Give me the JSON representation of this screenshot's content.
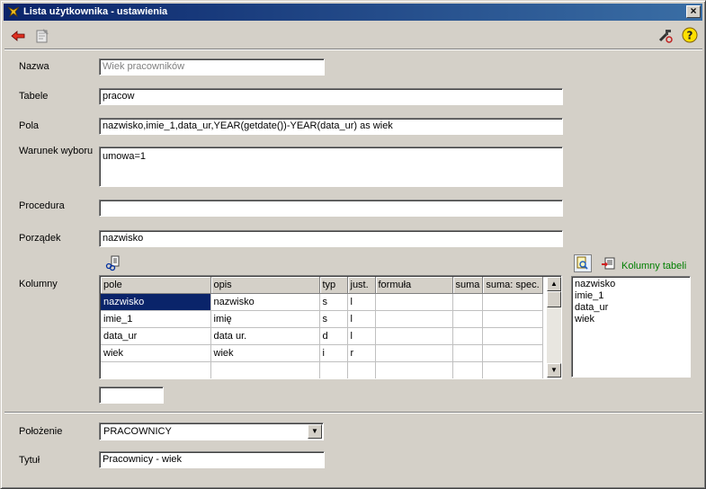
{
  "window": {
    "title": "Lista użytkownika - ustawienia",
    "close_glyph": "×"
  },
  "toolbar": {
    "left_icons": [
      "back-arrow-icon",
      "edit-icon"
    ],
    "right_icons": [
      "tools-icon",
      "help-icon"
    ]
  },
  "form": {
    "nazwa": {
      "label": "Nazwa",
      "value": "Wiek pracowników"
    },
    "tabele": {
      "label": "Tabele",
      "value": "pracow"
    },
    "pola": {
      "label": "Pola",
      "value": "nazwisko,imie_1,data_ur,YEAR(getdate())-YEAR(data_ur) as wiek"
    },
    "warunek": {
      "label": "Warunek wyboru",
      "value": "umowa=1"
    },
    "procedura": {
      "label": "Procedura",
      "value": ""
    },
    "porzadek": {
      "label": "Porządek",
      "value": "nazwisko"
    },
    "kolumny": {
      "label": "Kolumny"
    },
    "small_field": {
      "value": ""
    }
  },
  "grid": {
    "columns": [
      "pole",
      "opis",
      "typ",
      "just.",
      "formuła",
      "suma",
      "suma: spec."
    ],
    "rows": [
      [
        "nazwisko",
        "nazwisko",
        "s",
        "l",
        "",
        "",
        ""
      ],
      [
        "imie_1",
        "imię",
        "s",
        "l",
        "",
        "",
        ""
      ],
      [
        "data_ur",
        "data ur.",
        "d",
        "l",
        "",
        "",
        ""
      ],
      [
        "wiek",
        "wiek",
        "i",
        "r",
        "",
        "",
        ""
      ],
      [
        "",
        "",
        "",
        "",
        "",
        "",
        ""
      ]
    ],
    "selected_row": 0
  },
  "table_columns_panel": {
    "label": "Kolumny tabeli",
    "items": [
      "nazwisko",
      "imie_1",
      "data_ur",
      "wiek"
    ]
  },
  "bottom": {
    "polozenie": {
      "label": "Położenie",
      "value": "PRACOWNICY"
    },
    "tytul": {
      "label": "Tytuł",
      "value": "Pracownicy - wiek"
    }
  },
  "colors": {
    "window_bg": "#d4d0c8",
    "title_from": "#0a246a",
    "title_to": "#3a6ea5",
    "selection": "#0a246a",
    "link_green": "#007f00"
  }
}
